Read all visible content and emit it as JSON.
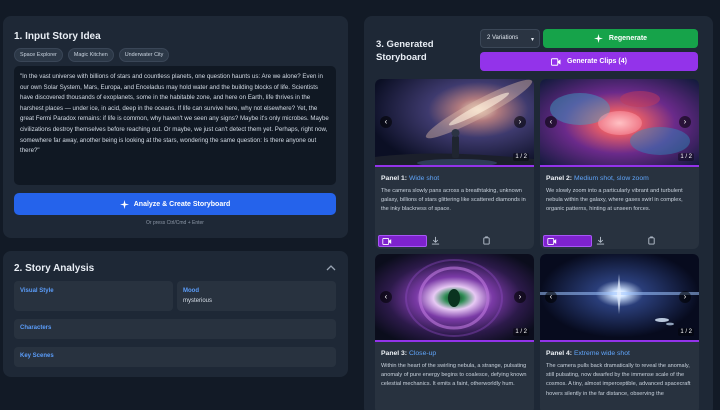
{
  "input": {
    "title": "1. Input Story Idea",
    "chips": [
      "Space Explorer",
      "Magic Kitchen",
      "Underwater City"
    ],
    "story": "\"In the vast universe with billions of stars and countless planets, one question haunts us: Are we alone? Even in our own Solar System, Mars, Europa, and Enceladus may hold water and the building blocks of life. Scientists have discovered thousands of exoplanets, some in the habitable zone, and here on Earth, life thrives in the harshest places — under ice, in acid, deep in the oceans. If life can survive here, why not elsewhere? Yet, the great Fermi Paradox remains: if life is common, why haven't we seen any signs? Maybe it's only microbes. Maybe civilizations destroy themselves before reaching out. Or maybe, we just can't detect them yet. Perhaps, right now, somewhere far away, another being is looking at the stars, wondering the same question: Is there anyone out there?\"",
    "analyze_label": "Analyze & Create Storyboard",
    "hint": "Or press Ctrl/Cmd + Enter"
  },
  "analysis": {
    "title": "2. Story Analysis",
    "visual_style_label": "Visual Style",
    "mood_label": "Mood",
    "mood_value": "mysterious",
    "characters_label": "Characters",
    "key_scenes_label": "Key Scenes"
  },
  "storyboard": {
    "title_line1": "3. Generated",
    "title_line2": "Storyboard",
    "variations": "2 Variations",
    "regenerate_label": "Regenerate",
    "clips_label": "Generate Clips (4)",
    "panels": [
      {
        "label": "Panel 1:",
        "shot": "Wide shot",
        "count": "1 / 2",
        "desc": "The camera slowly pans across a breathtaking, unknown galaxy, billions of stars glittering like scattered diamonds in the inky blackness of space."
      },
      {
        "label": "Panel 2:",
        "shot": "Medium shot, slow zoom",
        "count": "1 / 2",
        "desc": "We slowly zoom into a particularly vibrant and turbulent nebula within the galaxy, where gases swirl in complex, organic patterns, hinting at unseen forces."
      },
      {
        "label": "Panel 3:",
        "shot": "Close-up",
        "count": "1 / 2",
        "desc": "Within the heart of the swirling nebula, a strange, pulsating anomaly of pure energy begins to coalesce, defying known celestial mechanics. It emits a faint, otherworldly hum."
      },
      {
        "label": "Panel 4:",
        "shot": "Extreme wide shot",
        "count": "1 / 2",
        "desc": "The camera pulls back dramatically to reveal the anomaly, still pulsating, now dwarfed by the immense scale of the cosmos. A tiny, almost imperceptible, advanced spacecraft hovers silently in the far distance, observing the"
      }
    ]
  },
  "colors": {
    "accent_blue": "#2563eb",
    "green": "#16a34a",
    "purple": "#9333ea"
  }
}
